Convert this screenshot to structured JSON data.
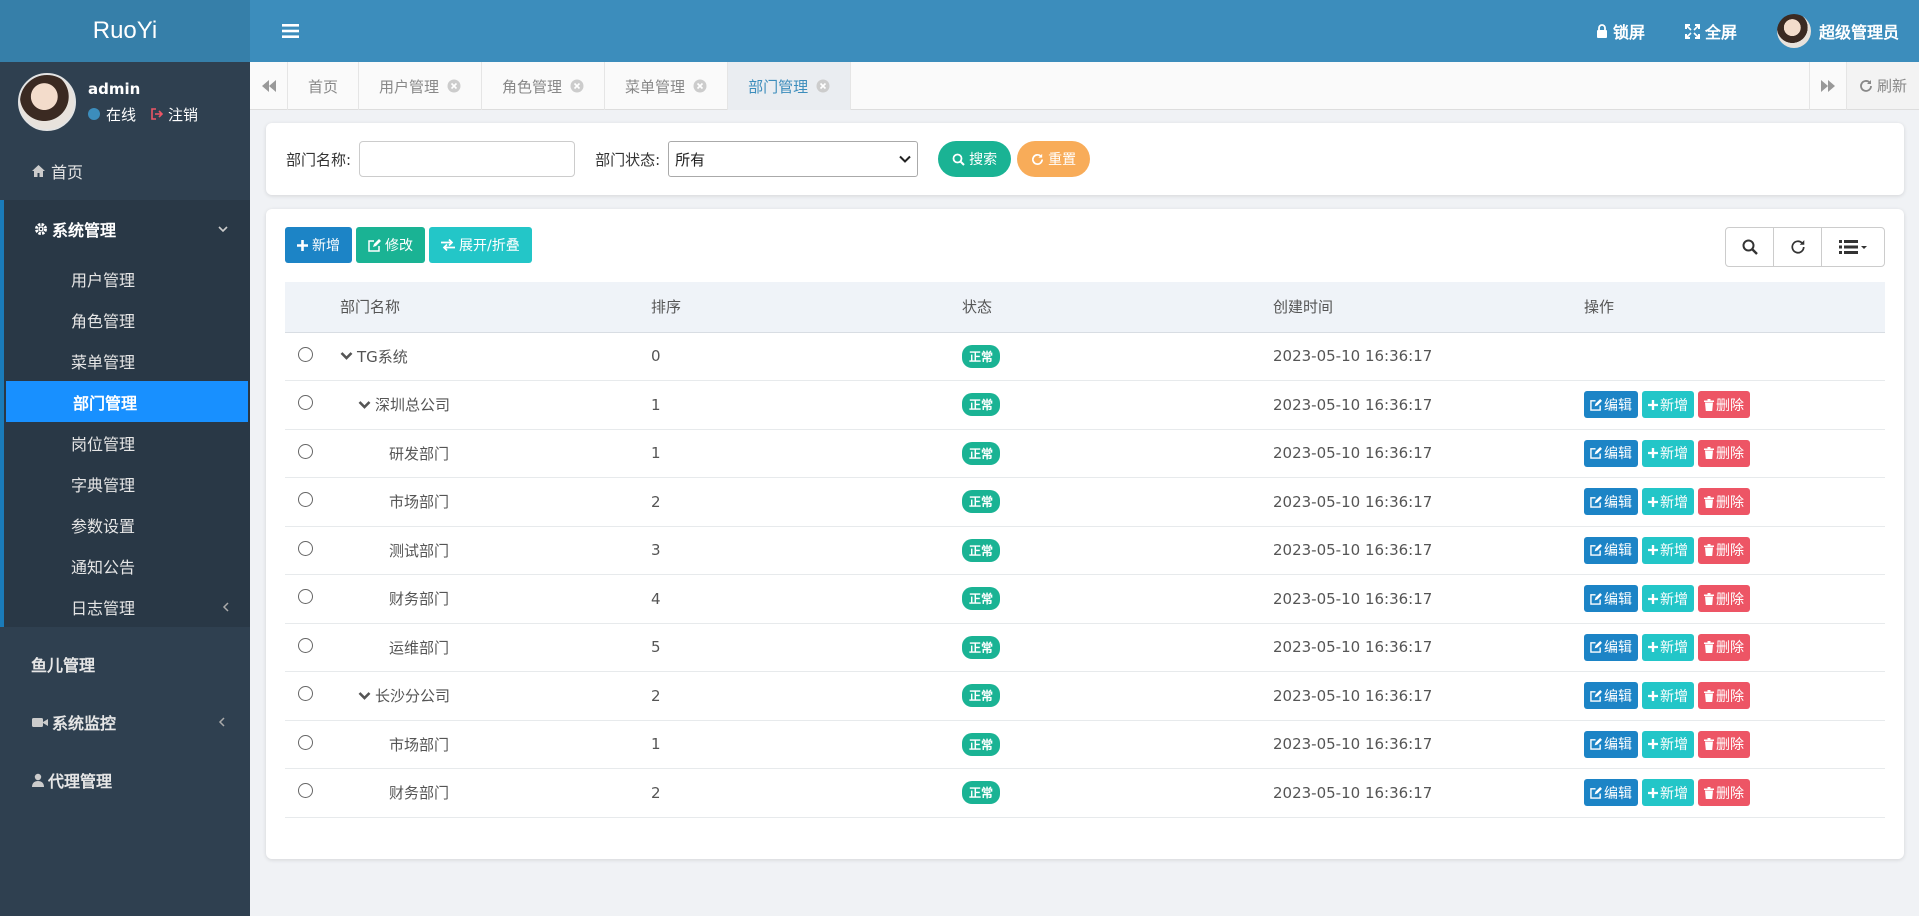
{
  "app": {
    "logo": "RuoYi"
  },
  "user_panel": {
    "name": "admin",
    "status": "在线",
    "logout": "注销"
  },
  "sidebar": {
    "home": "首页",
    "group": {
      "label": "系统管理"
    },
    "sub_items": [
      {
        "label": "用户管理"
      },
      {
        "label": "角色管理"
      },
      {
        "label": "菜单管理"
      },
      {
        "label": "部门管理",
        "active": true
      },
      {
        "label": "岗位管理"
      },
      {
        "label": "字典管理"
      },
      {
        "label": "参数设置"
      },
      {
        "label": "通知公告"
      },
      {
        "label": "日志管理"
      }
    ],
    "fish": "鱼儿管理",
    "monitor": "系统监控",
    "agent": "代理管理"
  },
  "header": {
    "lock": "锁屏",
    "fullscreen": "全屏",
    "user": "超级管理员"
  },
  "tabs": {
    "items": [
      {
        "label": "首页"
      },
      {
        "label": "用户管理"
      },
      {
        "label": "角色管理"
      },
      {
        "label": "菜单管理"
      },
      {
        "label": "部门管理",
        "active": true
      }
    ],
    "refresh": "刷新"
  },
  "search": {
    "name_label": "部门名称:",
    "name_value": "",
    "status_label": "部门状态:",
    "status_value": "所有",
    "search_btn": "搜索",
    "reset_btn": "重置"
  },
  "toolbar": {
    "add": "新增",
    "edit": "修改",
    "toggle": "展开/折叠"
  },
  "table": {
    "headers": {
      "name": "部门名称",
      "order": "排序",
      "status": "状态",
      "time": "创建时间",
      "ops": "操作"
    },
    "ops_labels": {
      "edit": "编辑",
      "add": "新增",
      "del": "删除"
    },
    "rows": [
      {
        "name": "TG系统",
        "level": 0,
        "expandable": true,
        "order": "0",
        "status": "正常",
        "time": "2023-05-10 16:36:17",
        "ops": false
      },
      {
        "name": "深圳总公司",
        "level": 1,
        "expandable": true,
        "order": "1",
        "status": "正常",
        "time": "2023-05-10 16:36:17",
        "ops": true
      },
      {
        "name": "研发部门",
        "level": 2,
        "expandable": false,
        "order": "1",
        "status": "正常",
        "time": "2023-05-10 16:36:17",
        "ops": true
      },
      {
        "name": "市场部门",
        "level": 2,
        "expandable": false,
        "order": "2",
        "status": "正常",
        "time": "2023-05-10 16:36:17",
        "ops": true
      },
      {
        "name": "测试部门",
        "level": 2,
        "expandable": false,
        "order": "3",
        "status": "正常",
        "time": "2023-05-10 16:36:17",
        "ops": true
      },
      {
        "name": "财务部门",
        "level": 2,
        "expandable": false,
        "order": "4",
        "status": "正常",
        "time": "2023-05-10 16:36:17",
        "ops": true
      },
      {
        "name": "运维部门",
        "level": 2,
        "expandable": false,
        "order": "5",
        "status": "正常",
        "time": "2023-05-10 16:36:17",
        "ops": true
      },
      {
        "name": "长沙分公司",
        "level": 1,
        "expandable": true,
        "order": "2",
        "status": "正常",
        "time": "2023-05-10 16:36:17",
        "ops": true
      },
      {
        "name": "市场部门",
        "level": 2,
        "expandable": false,
        "order": "1",
        "status": "正常",
        "time": "2023-05-10 16:36:17",
        "ops": true
      },
      {
        "name": "财务部门",
        "level": 2,
        "expandable": false,
        "order": "2",
        "status": "正常",
        "time": "2023-05-10 16:36:17",
        "ops": true
      }
    ]
  }
}
